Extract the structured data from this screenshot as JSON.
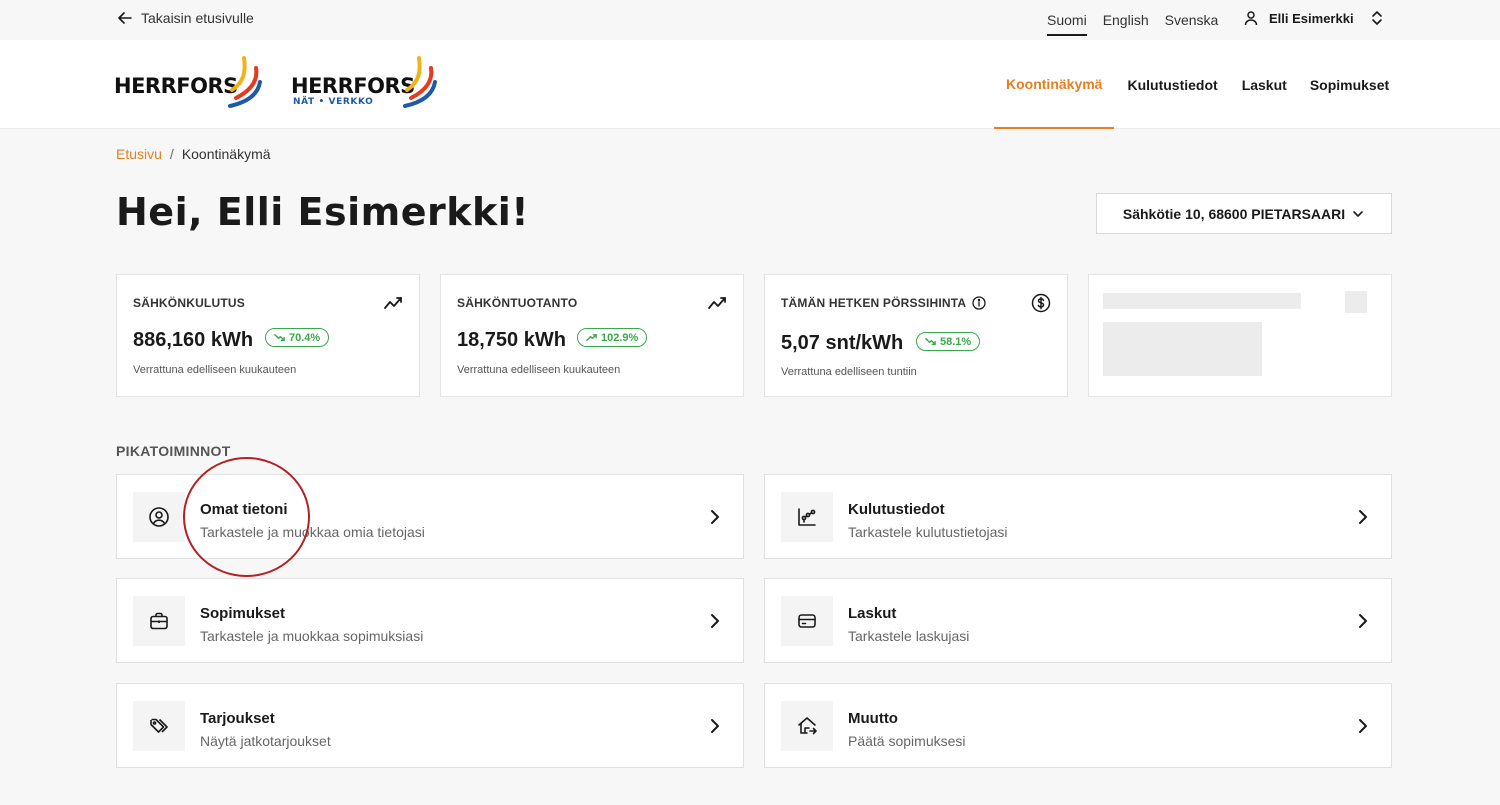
{
  "topbar": {
    "back_label": "Takaisin etusivulle",
    "languages": [
      "Suomi",
      "English",
      "Svenska"
    ],
    "active_language": "Suomi",
    "user_name": "Elli Esimerkki"
  },
  "logos": {
    "brand": "HERRFORS",
    "brand_sub": "NÄT • VERKKO"
  },
  "nav": {
    "items": [
      "Koontinäkymä",
      "Kulutustiedot",
      "Laskut",
      "Sopimukset"
    ],
    "active": "Koontinäkymä"
  },
  "breadcrumb": {
    "home": "Etusivu",
    "separator": "/",
    "current": "Koontinäkymä"
  },
  "page_title": "Hei, Elli Esimerkki!",
  "address_selector": "Sähkötie 10, 68600 PIETARSAARI",
  "stats": [
    {
      "label": "SÄHKÖNKULUTUS",
      "value": "886,160 kWh",
      "change": "70.4%",
      "trend": "down",
      "caption": "Verrattuna edelliseen kuukauteen",
      "icon": "trend-chart-icon"
    },
    {
      "label": "SÄHKÖNTUOTANTO",
      "value": "18,750 kWh",
      "change": "102.9%",
      "trend": "up",
      "caption": "Verrattuna edelliseen kuukauteen",
      "icon": "trend-chart-icon"
    },
    {
      "label": "TÄMÄN HETKEN PÖRSSIHINTA",
      "value": "5,07 snt/kWh",
      "change": "58.1%",
      "trend": "down",
      "caption": "Verrattuna edelliseen tuntiin",
      "icon": "dollar-circle-icon"
    }
  ],
  "quick_actions": {
    "title": "PIKATOIMINNOT",
    "items": [
      {
        "title": "Omat tietoni",
        "subtitle": "Tarkastele ja muokkaa omia tietojasi",
        "icon": "user-circle-icon"
      },
      {
        "title": "Kulutustiedot",
        "subtitle": "Tarkastele kulutustietojasi",
        "icon": "chart-icon"
      },
      {
        "title": "Sopimukset",
        "subtitle": "Tarkastele ja muokkaa sopimuksiasi",
        "icon": "briefcase-icon"
      },
      {
        "title": "Laskut",
        "subtitle": "Tarkastele laskujasi",
        "icon": "credit-card-icon"
      },
      {
        "title": "Tarjoukset",
        "subtitle": "Näytä jatkotarjoukset",
        "icon": "tags-icon"
      },
      {
        "title": "Muutto",
        "subtitle": "Päätä sopimuksesi",
        "icon": "house-move-icon"
      }
    ]
  },
  "colors": {
    "accent": "#e57f1f",
    "positive": "#3aa74a",
    "highlight": "#b22222"
  }
}
